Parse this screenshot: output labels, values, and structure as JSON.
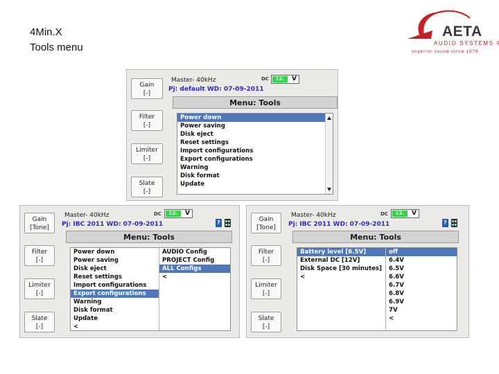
{
  "slide": {
    "title_line1": "4Min.X",
    "title_line2": "Tools menu"
  },
  "logo": {
    "name": "AETA",
    "sub": "AUDIO SYSTEMS",
    "reg": "®",
    "tagline": "superior sound since 1978",
    "brand_color": "#c42026"
  },
  "dc": {
    "label": "DC",
    "value": "12.",
    "unit": "V"
  },
  "colors": {
    "selection": "#4f78b8",
    "dc_green": "#39d04b",
    "project_text": "#2b2bb8"
  },
  "screens": {
    "top": {
      "buttons": {
        "gain": [
          "Gain",
          "[-]"
        ],
        "filter": [
          "Filter",
          "[-]"
        ],
        "limiter": [
          "Limiter",
          "[-]"
        ],
        "slate": [
          "Slate",
          "[-]"
        ]
      },
      "master": "Master- 40kHz",
      "project_line": "Pj: default  WD: 07-09-2011",
      "menu_title": "Menu: Tools",
      "items": [
        "Power down",
        "Power saving",
        "Disk eject",
        "Reset settings",
        "Import configurations",
        "Export configurations",
        "Warning",
        "Disk format",
        "Update"
      ],
      "selected_index": 0
    },
    "left": {
      "buttons": {
        "gain": [
          "Gain",
          "[Tone]"
        ],
        "filter": [
          "Filter",
          "[-]"
        ],
        "limiter": [
          "Limiter",
          "[-]"
        ],
        "slate": [
          "Slate",
          "[-]"
        ]
      },
      "master": "Master- 40kHz",
      "project_line": "Pj: IBC 2011  WD: 07-09-2011",
      "menu_title": "Menu: Tools",
      "items": [
        "Power down",
        "Power saving",
        "Disk eject",
        "Reset settings",
        "Import configurations",
        "Export configurations",
        "Warning",
        "Disk format",
        "Update",
        "<"
      ],
      "selected_index": 5,
      "submenu": [
        "AUDIO Config",
        "PROJECT Config",
        "ALL Configs",
        "<"
      ],
      "submenu_selected_index": 2
    },
    "right": {
      "buttons": {
        "gain": [
          "Gain",
          "[Tone]"
        ],
        "filter": [
          "Filter",
          "[-]"
        ],
        "limiter": [
          "Limiter",
          "[-]"
        ],
        "slate": [
          "Slate",
          "[-]"
        ]
      },
      "master": "Master- 40kHz",
      "project_line": "Pj: IBC 2011  WD: 07-09-2011",
      "menu_title": "Menu: Tools",
      "items": [
        "Battery level [6.5V]",
        "External DC [12V]",
        "Disk Space [30 minutes]",
        "<"
      ],
      "selected_index": 0,
      "submenu": [
        "off",
        "6.4V",
        "6.5V",
        "6.6V",
        "6.7V",
        "6.8V",
        "6.9V",
        "7V",
        "<"
      ],
      "submenu_selected_index": 0
    }
  }
}
